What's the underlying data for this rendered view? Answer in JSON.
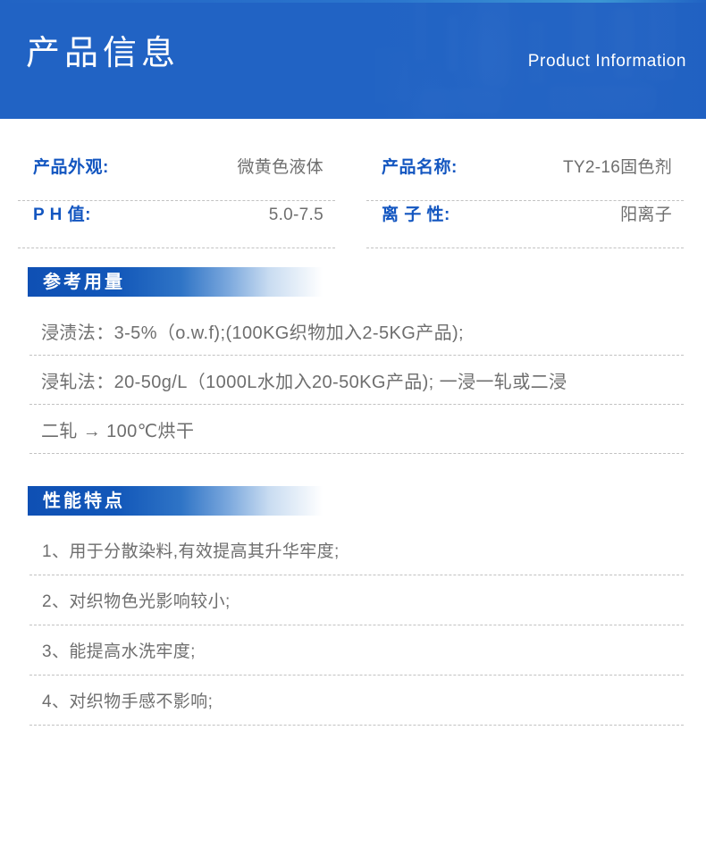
{
  "header": {
    "title": "产品信息",
    "subtitle": "Product Information",
    "background_color": "#2163c4",
    "text_color": "#ffffff"
  },
  "specs": {
    "label_color": "#1356c0",
    "value_color": "#6e6e6e",
    "left_column": [
      {
        "label": "产品外观:",
        "value": "微黄色液体"
      },
      {
        "label": "P H 值:",
        "value": "5.0-7.5"
      }
    ],
    "right_column": [
      {
        "label": "产品名称:",
        "value": "TY2-16固色剂"
      },
      {
        "label": "离 子 性:",
        "value": "阳离子"
      }
    ]
  },
  "dosage": {
    "section_title": "参考用量",
    "rows": [
      "浸渍法：3-5%（o.w.f);(100KG织物加入2-5KG产品);",
      "浸轧法：20-50g/L（1000L水加入20-50KG产品); 一浸一轧或二浸",
      "二轧 → 100℃烘干"
    ]
  },
  "features": {
    "section_title": "性能特点",
    "rows": [
      "1、用于分散染料,有效提高其升华牢度;",
      "2、对织物色光影响较小;",
      "3、能提高水洗牢度;",
      "4、对织物手感不影响;"
    ]
  }
}
